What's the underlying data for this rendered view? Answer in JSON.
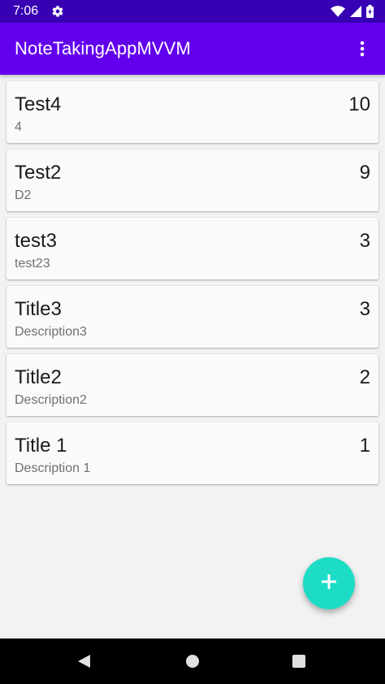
{
  "status_bar": {
    "time": "7:06",
    "icons": [
      "settings-gear-icon",
      "wifi-icon",
      "cell-signal-icon",
      "battery-icon"
    ]
  },
  "app_bar": {
    "title": "NoteTakingAppMVVM",
    "overflow_icon": "more-vert-icon"
  },
  "notes": [
    {
      "title": "Test4",
      "description": "4",
      "priority": "10"
    },
    {
      "title": "Test2",
      "description": "D2",
      "priority": "9"
    },
    {
      "title": "test3",
      "description": "test23",
      "priority": "3"
    },
    {
      "title": "Title3",
      "description": "Description3",
      "priority": "3"
    },
    {
      "title": "Title2",
      "description": "Description2",
      "priority": "2"
    },
    {
      "title": "Title 1",
      "description": "Description 1",
      "priority": "1"
    }
  ],
  "fab": {
    "icon": "add-icon",
    "color": "#1ddcc6"
  },
  "colors": {
    "status_bar": "#3700b3",
    "app_bar": "#6200ee",
    "background": "#f2f2f2",
    "card": "#fafafa"
  },
  "nav_bar": {
    "icons": [
      "back-icon",
      "home-icon",
      "recents-icon"
    ]
  }
}
